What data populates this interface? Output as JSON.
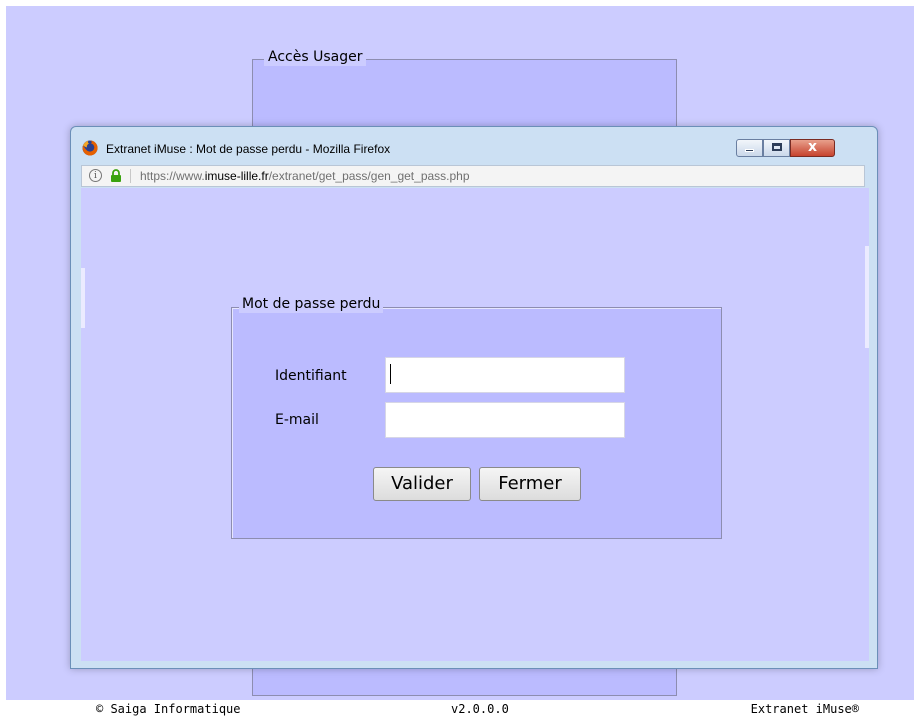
{
  "background": {
    "fieldset_legend": "Accès Usager"
  },
  "window": {
    "title": "Extranet iMuse : Mot de passe perdu - Mozilla Firefox",
    "close_glyph": "x",
    "url": {
      "prefix": "https://www.",
      "domain": "imuse-lille.fr",
      "path": "/extranet/get_pass/gen_get_pass.php"
    }
  },
  "form": {
    "legend": "Mot de passe perdu",
    "fields": {
      "identifiant_label": "Identifiant",
      "identifiant_value": "",
      "email_label": "E-mail",
      "email_value": ""
    },
    "buttons": {
      "valider": "Valider",
      "fermer": "Fermer"
    }
  },
  "footer": {
    "copyright": "© Saiga Informatique",
    "version": "v2.0.0.0",
    "product": "Extranet iMuse®"
  },
  "icons": [
    "firefox-icon",
    "info-icon",
    "lock-icon",
    "minimize-icon",
    "maximize-icon",
    "close-icon"
  ],
  "colors": {
    "page_background": "#ccccff",
    "fieldset_background": "#bbbbff",
    "window_frame": "#cce0f3",
    "close_button": "#c7432e"
  }
}
